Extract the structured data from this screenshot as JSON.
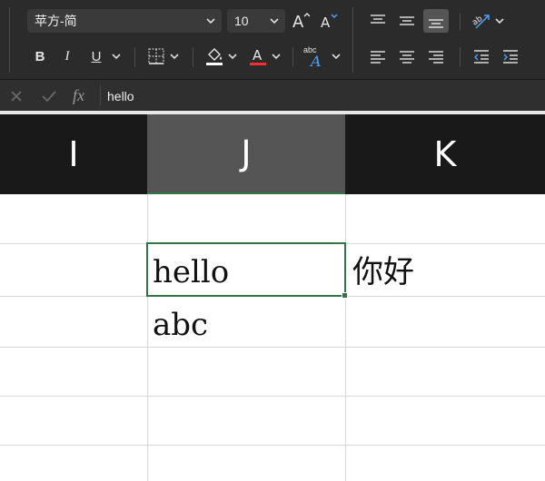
{
  "ribbon": {
    "font_name": "苹方-简",
    "font_size": "10",
    "bold": "B",
    "italic": "I",
    "underline": "U",
    "fill_color": "#ffffff",
    "font_color": "#ff2d2d",
    "wrap_label": "abc"
  },
  "formula_bar": {
    "cancel_icon": "close-icon",
    "confirm_icon": "check-icon",
    "fx_label": "fx",
    "value": "hello"
  },
  "columns": [
    {
      "label": "I",
      "selected": false
    },
    {
      "label": "J",
      "selected": true
    },
    {
      "label": "K",
      "selected": false
    }
  ],
  "cells": {
    "J2": "hello",
    "K2": "你好",
    "J3": "abc"
  },
  "colors": {
    "selection": "#2f7545",
    "header_bg": "#191919",
    "header_selected_bg": "#555555"
  }
}
